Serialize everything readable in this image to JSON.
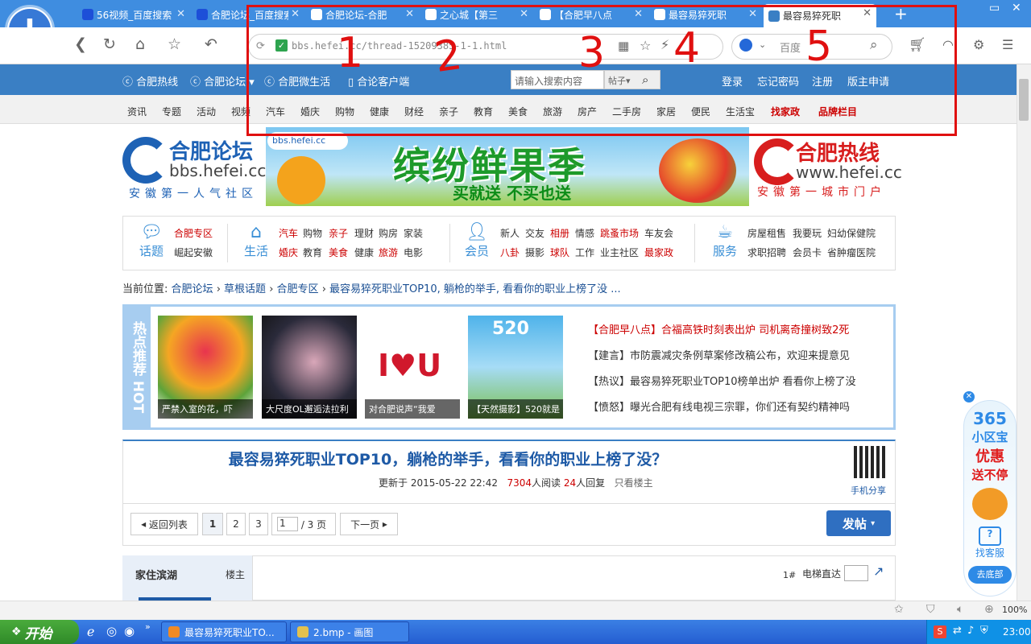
{
  "browser": {
    "tabs": [
      {
        "label": "56视频_百度搜索"
      },
      {
        "label": "合肥论坛_百度搜索"
      },
      {
        "label": "合肥论坛-合肥"
      },
      {
        "label": "之心城【第三"
      },
      {
        "label": "【合肥早八点"
      },
      {
        "label": "最容易猝死职"
      },
      {
        "label": "最容易猝死职"
      }
    ],
    "new_tab": "+",
    "url": "bbs.hefei.cc/thread-15209385-1-1.html",
    "search_engine": "百度",
    "win_controls": {
      "min": "▭",
      "close": "✕"
    }
  },
  "site_header": {
    "links": [
      "合肥热线",
      "合肥论坛",
      "合肥微生活",
      "合论客户端"
    ],
    "search_placeholder": "请输入搜索内容",
    "search_scope": "帖子",
    "account_links": [
      "登录",
      "忘记密码",
      "注册",
      "版主申请"
    ]
  },
  "categories": [
    "资讯",
    "专题",
    "活动",
    "视频",
    "汽车",
    "婚庆",
    "购物",
    "健康",
    "财经",
    "亲子",
    "教育",
    "美食",
    "旅游",
    "房产",
    "二手房",
    "家居",
    "便民",
    "生活宝",
    "找家政",
    "品牌栏目"
  ],
  "brand_left": {
    "name": "合肥论坛",
    "url": "bbs.hefei.cc",
    "slogan": "安徽第一人气社区"
  },
  "brand_right": {
    "name": "合肥热线",
    "url": "www.hefei.cc",
    "slogan": "安徽第一城市门户"
  },
  "ad": {
    "badge": "bbs.hefei.cc",
    "headline": "缤纷鲜果季",
    "sub": "买就送  不买也送"
  },
  "portal": {
    "groups": [
      {
        "title": "话题",
        "links": [
          "合肥专区",
          "崛起安徽"
        ]
      },
      {
        "title": "生活",
        "links": [
          "汽车",
          "购物",
          "亲子",
          "理财",
          "购房",
          "家装",
          "婚庆",
          "教育",
          "美食",
          "健康",
          "旅游",
          "电影"
        ]
      },
      {
        "title": "会员",
        "links": [
          "新人",
          "交友",
          "相册",
          "情感",
          "跳蚤市场",
          "车友会",
          "八卦",
          "摄影",
          "球队",
          "工作",
          "业主社区",
          "最家政"
        ]
      },
      {
        "title": "服务",
        "links": [
          "房屋租售",
          "我要玩",
          "妇幼保健院",
          "求职招聘",
          "会员卡",
          "省肿瘤医院"
        ]
      }
    ]
  },
  "breadcrumb": {
    "prefix": "当前位置:",
    "items": [
      "合肥论坛",
      "草根话题",
      "合肥专区",
      "最容易猝死职业TOP10, 躺枪的举手, 看看你的职业上榜了没 ..."
    ],
    "sep": "›"
  },
  "hot": {
    "label": "热点推荐 HOT",
    "thumbs": [
      "严禁入室的花，吓",
      "大尺度OL邂逅法拉利",
      "对合肥说声“我爱",
      "【天然摄影】520就是"
    ],
    "news": [
      "【合肥早八点】合福高铁时刻表出炉 司机离奇撞树致2死",
      "【建言】市防震减灾条例草案修改稿公布，欢迎来提意见",
      "【热议】最容易猝死职业TOP10榜单出炉 看看你上榜了没",
      "【愤怒】曝光合肥有线电视三宗罪，你们还有契约精神吗"
    ]
  },
  "thread": {
    "title": "最容易猝死职业TOP10，躺枪的举手，看看你的职业上榜了没？",
    "updated_label": "更新于",
    "updated": "2015-05-22 22:42",
    "views": "7304",
    "views_label": "人阅读",
    "replies": "24",
    "replies_label": "人回复",
    "only_op": "只看楼主",
    "mobile_share": "手机分享"
  },
  "pager": {
    "back": "返回列表",
    "pages": [
      "1",
      "2",
      "3"
    ],
    "current": "1",
    "total": "/ 3 页",
    "next": "下一页",
    "post": "发帖"
  },
  "post": {
    "author": "家住滨湖",
    "op_label": "楼主",
    "floor": "1#",
    "jump_label": "电梯直达"
  },
  "float_ad": {
    "num": "365",
    "name": "小区宝",
    "promo1": "优惠",
    "promo2": "送不停",
    "service": "找客服",
    "bottom": "去底部"
  },
  "statusbar": {
    "zoom": "100%"
  },
  "taskbar": {
    "start": "开始",
    "items": [
      "最容易猝死职业TO...",
      "2.bmp - 画图"
    ],
    "clock": "23:00"
  },
  "annotation": {
    "digits": [
      "1",
      "2",
      "3",
      "4",
      "5"
    ]
  }
}
